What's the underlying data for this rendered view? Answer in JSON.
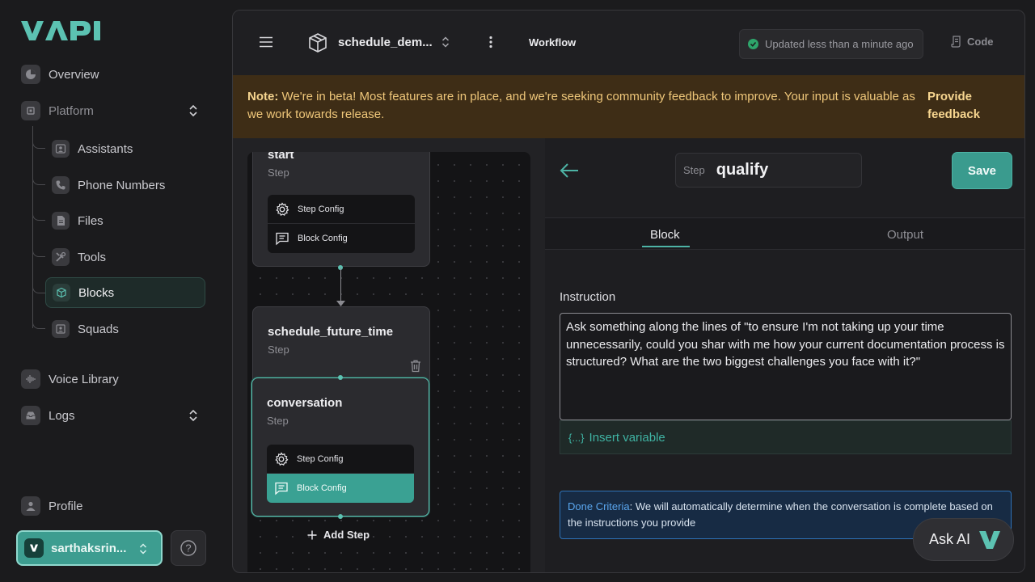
{
  "brand": {
    "logo_text": "VAPI",
    "accent": "#5cc2b2"
  },
  "sidebar": {
    "overview": "Overview",
    "platform": "Platform",
    "platform_items": [
      {
        "label": "Assistants",
        "icon": "assistant-icon"
      },
      {
        "label": "Phone Numbers",
        "icon": "phone-icon"
      },
      {
        "label": "Files",
        "icon": "file-icon"
      },
      {
        "label": "Tools",
        "icon": "tools-icon"
      },
      {
        "label": "Blocks",
        "icon": "blocks-icon",
        "active": true
      },
      {
        "label": "Squads",
        "icon": "squads-icon"
      }
    ],
    "voice_library": "Voice Library",
    "logs": "Logs",
    "profile": "Profile",
    "account": "sarthaksrin...",
    "help": "?"
  },
  "topbar": {
    "project_name": "schedule_dem...",
    "mode": "Workflow",
    "status": "Updated less than a minute ago",
    "code_label": "Code"
  },
  "banner": {
    "note_label": "Note:",
    "message": "We're in beta! Most features are in place, and we're seeking community feedback to improve. Your input is valuable as we work towards release.",
    "link": "Provide feedback"
  },
  "canvas": {
    "nodes": [
      {
        "title": "start",
        "subtitle": "Step",
        "step_config": "Step Config",
        "block_config": "Block Config"
      },
      {
        "title": "schedule_future_time",
        "subtitle": "Step"
      },
      {
        "title": "conversation",
        "subtitle": "Step",
        "step_config": "Step Config",
        "block_config": "Block Config",
        "selected": true
      }
    ],
    "add_step": "Add Step"
  },
  "editor": {
    "step_label": "Step",
    "step_name": "qualify",
    "save": "Save",
    "tabs": [
      "Block",
      "Output"
    ],
    "active_tab": "Block",
    "instruction_label": "Instruction",
    "instruction": "Ask something along the lines of \"to ensure I'm not taking up your time unnecessarily, could you shar with me how your current documentation process is structured? What are the two biggest challenges you face with it?\"",
    "insert_variable": "Insert variable",
    "insert_variable_icon": "{...}",
    "done_criteria_key": "Done Criteria",
    "done_criteria_text": ": We will automatically determine when the conversation is complete based on the instructions you provide"
  },
  "ask_ai": "Ask AI"
}
